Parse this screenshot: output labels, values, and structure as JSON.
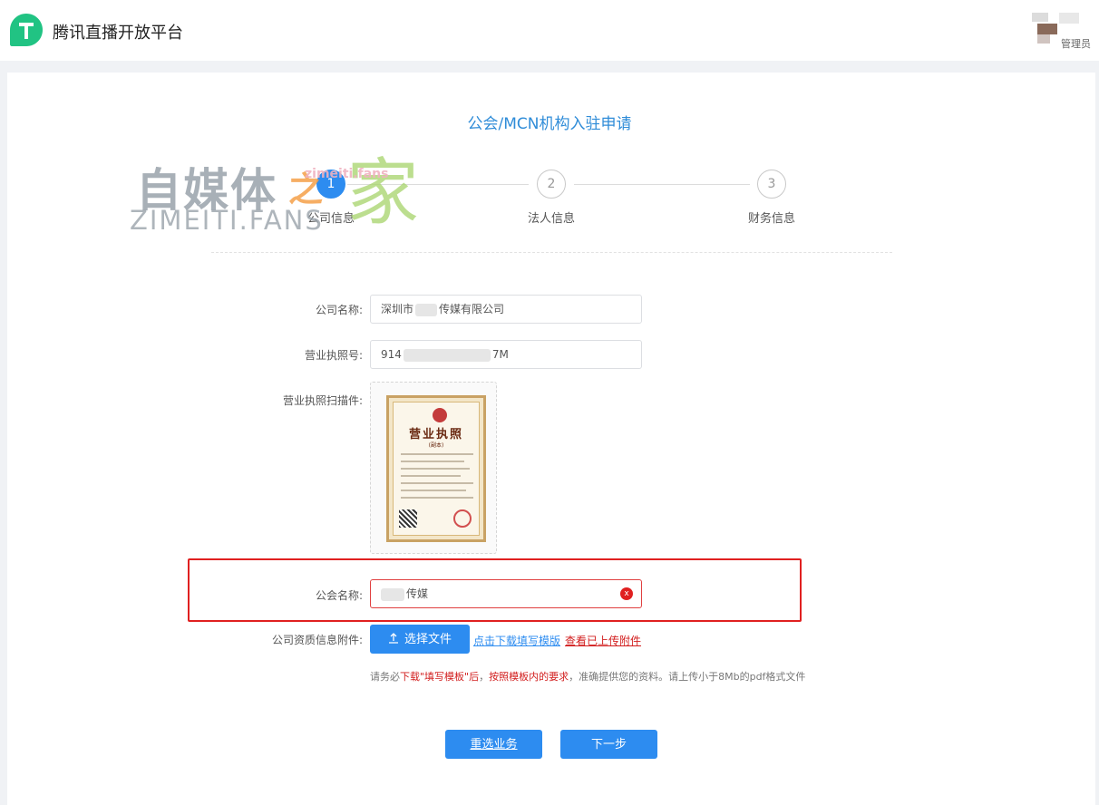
{
  "header": {
    "brand": "腾讯直播开放平台",
    "user_role": "管理员",
    "brand_color": "#21c383"
  },
  "page_title": "公会/MCN机构入驻申请",
  "steps": [
    {
      "number": "1",
      "label": "公司信息",
      "active": true
    },
    {
      "number": "2",
      "label": "法人信息",
      "active": false
    },
    {
      "number": "3",
      "label": "财务信息",
      "active": false
    }
  ],
  "watermark": {
    "cn": "自媒体",
    "zhi": "之",
    "jia": "家",
    "en": "ZIMEITI.FANS",
    "url": "zimeiti.fans"
  },
  "form": {
    "company_name": {
      "label": "公司名称:",
      "prefix": "深圳市",
      "suffix": "传媒有限公司"
    },
    "license_no": {
      "label": "营业执照号:",
      "prefix": "914",
      "suffix": "7M"
    },
    "license_scan": {
      "label": "营业执照扫描件:",
      "doc_title": "营业执照",
      "doc_subtitle": "(副本)"
    },
    "guild_name": {
      "label": "公会名称:",
      "suffix": "传媒",
      "clear_glyph": "x"
    },
    "attachment": {
      "label": "公司资质信息附件:",
      "upload_button": "选择文件",
      "download_link": "点击下载填写模版",
      "view_link": "查看已上传附件"
    }
  },
  "note": {
    "part1": "请务必",
    "part2": "下载\"填写模板\"后",
    "part3": "，",
    "part4": "按照模板内的要求",
    "part5": "，准确提供您的资料。请上传小于8Mb的pdf格式文件"
  },
  "buttons": {
    "reset": "重选业务",
    "next": "下一步"
  },
  "colors": {
    "primary": "#2d8cf0",
    "title": "#2f8cd8",
    "error": "#e02020"
  },
  "icons": {
    "logo": "tencent-live-logo-icon",
    "upload": "upload-arrow-icon",
    "clear": "clear-circle-icon"
  }
}
